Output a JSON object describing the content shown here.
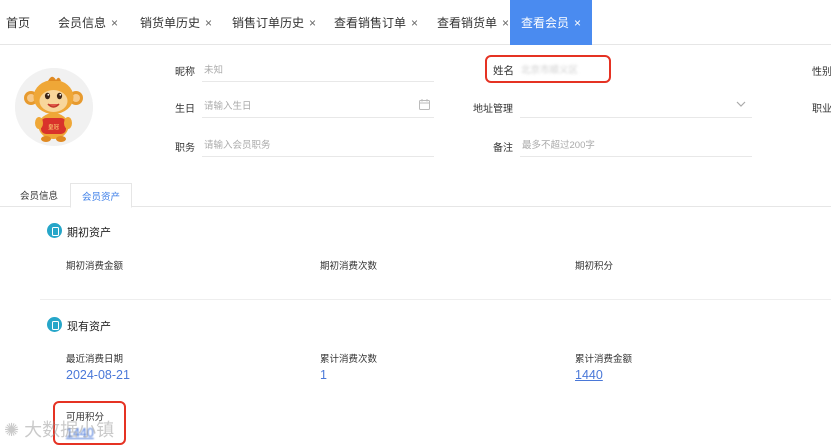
{
  "tabs": [
    {
      "label": "首页",
      "closable": false
    },
    {
      "label": "会员信息",
      "closable": true
    },
    {
      "label": "销货单历史",
      "closable": true
    },
    {
      "label": "销售订单历史",
      "closable": true
    },
    {
      "label": "查看销售订单",
      "closable": true
    },
    {
      "label": "查看销货单",
      "closable": true
    },
    {
      "label": "查看会员",
      "closable": true,
      "active": true
    }
  ],
  "close_glyph": "×",
  "profile": {
    "avatar_badge": "皇冠",
    "nickname_label": "昵称",
    "nickname_value": "未知",
    "name_label": "姓名",
    "name_value": "北京市顺义区",
    "gender_label": "性别",
    "birthday_label": "生日",
    "birthday_placeholder": "请输入生日",
    "address_label": "地址管理",
    "occupation_label": "职业",
    "position_label": "职务",
    "position_placeholder": "请输入会员职务",
    "remark_label": "备注",
    "remark_placeholder": "最多不超过200字"
  },
  "subtabs": [
    {
      "label": "会员信息",
      "active": false
    },
    {
      "label": "会员资产",
      "active": true
    }
  ],
  "initial_assets": {
    "title": "期初资产",
    "items": [
      {
        "label": "期初消费金额"
      },
      {
        "label": "期初消费次数"
      },
      {
        "label": "期初积分"
      }
    ]
  },
  "current_assets": {
    "title": "现有资产",
    "items": [
      {
        "label": "最近消费日期",
        "value": "2024-08-21"
      },
      {
        "label": "累计消费次数",
        "value": "1"
      },
      {
        "label": "累计消费金额",
        "value": "1440"
      }
    ],
    "points_label": "可用积分",
    "points_value": "1440"
  },
  "watermark": "大数据小镇",
  "colors": {
    "active_tab": "#4a8bf0",
    "link": "#4a78d8",
    "highlight_box": "#e53223",
    "section_icon": "#26a6c9"
  },
  "icons": {
    "calendar": "calendar-icon",
    "dropdown": "chevron-down-icon",
    "section": "wallet-icon"
  }
}
